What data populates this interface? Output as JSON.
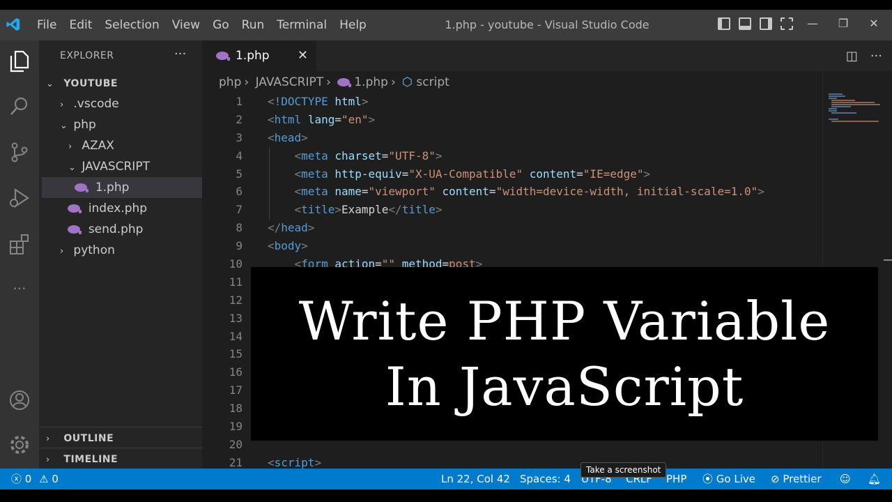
{
  "titlebar": {
    "menu": [
      "File",
      "Edit",
      "Selection",
      "View",
      "Go",
      "Run",
      "Terminal",
      "Help"
    ],
    "window_title": "1.php - youtube - Visual Studio Code",
    "minimize": "—",
    "restore": "❐",
    "close": "✕"
  },
  "sidebar": {
    "header": "EXPLORER",
    "more": "···",
    "root": "YOUTUBE",
    "items": [
      {
        "label": ".vscode"
      },
      {
        "label": "php"
      },
      {
        "label": "AZAX"
      },
      {
        "label": "JAVASCRIPT"
      },
      {
        "label": "1.php"
      },
      {
        "label": "index.php"
      },
      {
        "label": "send.php"
      },
      {
        "label": "python"
      }
    ],
    "outline": "OUTLINE",
    "timeline": "TIMELINE"
  },
  "editor": {
    "tab_label": "1.php",
    "tab_close": "✕",
    "breadcrumb": [
      "php",
      "JAVASCRIPT",
      "1.php",
      "script"
    ],
    "lines": [
      {
        "n": "1"
      },
      {
        "n": "2"
      },
      {
        "n": "3"
      },
      {
        "n": "4"
      },
      {
        "n": "5"
      },
      {
        "n": "6"
      },
      {
        "n": "7"
      },
      {
        "n": "8"
      },
      {
        "n": "9"
      },
      {
        "n": "10"
      },
      {
        "n": "11"
      },
      {
        "n": "12"
      },
      {
        "n": "13"
      },
      {
        "n": "14"
      },
      {
        "n": "15"
      },
      {
        "n": "16"
      },
      {
        "n": "17"
      },
      {
        "n": "18"
      },
      {
        "n": "19"
      },
      {
        "n": "20"
      },
      {
        "n": "21"
      }
    ],
    "code": {
      "doctype": "!DOCTYPE",
      "html": "html",
      "lang_attr": "lang",
      "lang_val": "\"en\"",
      "head": "head",
      "meta": "meta",
      "charset": "charset",
      "charset_val": "\"UTF-8\"",
      "http_equiv": "http-equiv",
      "http_equiv_val": "\"X-UA-Compatible\"",
      "content": "content",
      "content_val1": "\"IE=edge\"",
      "name": "name",
      "name_val": "\"viewport\"",
      "content_val2": "\"width=device-width, initial-scale=1.0\"",
      "title": "title",
      "title_text": "Example",
      "body": "body",
      "form": "form",
      "action": "action",
      "action_val": "\"\"",
      "method": "method",
      "method_val": "post",
      "script": "script"
    }
  },
  "overlay": {
    "line1": "Write PHP Variable",
    "line2": "In JavaScript"
  },
  "statusbar": {
    "errors": "0",
    "warnings": "0",
    "position": "Ln 22, Col 42",
    "spaces": "Spaces: 4",
    "encoding": "UTF-8",
    "eol": "CRLF",
    "language": "PHP",
    "golive": "Go Live",
    "prettier": "Prettier",
    "tooltip": "Take a screenshot"
  },
  "colors": {
    "statusbar": "#007acc",
    "activitybar": "#333333",
    "sidebar": "#252526",
    "editor": "#1e1e1e",
    "php_icon": "#a074c4"
  }
}
